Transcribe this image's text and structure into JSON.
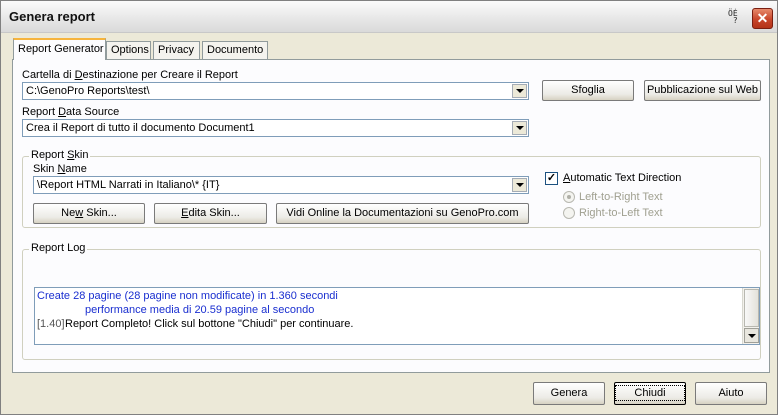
{
  "window": {
    "title": "Genera report",
    "help_glyph": "ÖĖ\n ?",
    "close_glyph": "✕"
  },
  "tabs": [
    {
      "label": "Report Generator",
      "active": true
    },
    {
      "label": "Options"
    },
    {
      "label": "Privacy"
    },
    {
      "label": "Documento"
    }
  ],
  "destination": {
    "label_pre": "Cartella di ",
    "label_u": "D",
    "label_post": "estinazione per Creare il Report",
    "value": "C:\\GenoPro Reports\\test\\",
    "browse_label": "Sfoglia",
    "publish_label": "Pubblicazione sul Web"
  },
  "data_source": {
    "label_pre": "Report ",
    "label_u": "D",
    "label_post": "ata Source",
    "value": "Crea il Report di tutto il documento Document1"
  },
  "skin": {
    "group_pre": "Report ",
    "group_u": "S",
    "group_post": "kin",
    "name_pre": "Skin ",
    "name_u": "N",
    "name_post": "ame",
    "value": "\\Report HTML Narrati in Italiano\\*  {IT}",
    "new_pre": "Ne",
    "new_u": "w",
    "new_post": " Skin...",
    "edit_pre": "",
    "edit_u": "E",
    "edit_post": "dita Skin...",
    "docs_label": "Vidi Online la Documentazioni su GenoPro.com",
    "auto_dir_pre": "",
    "auto_dir_u": "A",
    "auto_dir_post": "utomatic Text Direction",
    "auto_dir_checked": true,
    "ltr_label": "Left-to-Right Text",
    "rtl_label": "Right-to-Left Text"
  },
  "log": {
    "title": "Report Log",
    "lines": [
      "Create 28 pagine (28 pagine non modificate) in 1.360 secondi",
      "performance media di 20.59 pagine al secondo",
      "[1.40]",
      "Report Completo!  Click sul bottone \"Chiudi\" per continuare."
    ]
  },
  "footer": {
    "generate": "Genera",
    "close": "Chiudi",
    "help": "Aiuto"
  },
  "colors": {
    "log_blue": "#1a2fd0",
    "log_gray": "#555555"
  }
}
